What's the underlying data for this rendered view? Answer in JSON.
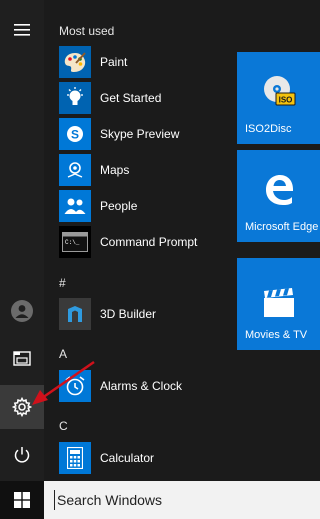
{
  "rail": {
    "items": [
      {
        "name": "hamburger-menu-icon"
      },
      {
        "name": "user-avatar-icon"
      },
      {
        "name": "file-explorer-icon"
      },
      {
        "name": "settings-gear-icon"
      },
      {
        "name": "power-icon"
      }
    ]
  },
  "sections": {
    "most_used": "Most used",
    "hash": "#",
    "a": "A",
    "c": "C"
  },
  "apps": [
    {
      "label": "Paint",
      "icon": "paint-palette-icon",
      "color": "#0063b1"
    },
    {
      "label": "Get Started",
      "icon": "lightbulb-icon",
      "color": "#0063b1"
    },
    {
      "label": "Skype Preview",
      "icon": "skype-icon",
      "color": "#0078d7"
    },
    {
      "label": "Maps",
      "icon": "maps-icon",
      "color": "#0078d7"
    },
    {
      "label": "People",
      "icon": "people-icon",
      "color": "#0078d7"
    },
    {
      "label": "Command Prompt",
      "icon": "command-prompt-icon",
      "color": "#000000"
    },
    {
      "label": "3D Builder",
      "icon": "3d-builder-icon",
      "color": "#3a3a3a"
    },
    {
      "label": "Alarms & Clock",
      "icon": "alarm-clock-icon",
      "color": "#0078d7"
    },
    {
      "label": "Calculator",
      "icon": "calculator-icon",
      "color": "#0078d7"
    }
  ],
  "tiles": [
    {
      "label": "ISO2Disc",
      "icon": "disc-iso-icon"
    },
    {
      "label": "Microsoft Edge",
      "icon": "edge-icon"
    },
    {
      "label": "Movies & TV",
      "icon": "clapperboard-icon"
    }
  ],
  "taskbar": {
    "search_text": "Search Windows"
  },
  "colors": {
    "accent": "#0a78d7",
    "arrow": "#d0111b"
  }
}
